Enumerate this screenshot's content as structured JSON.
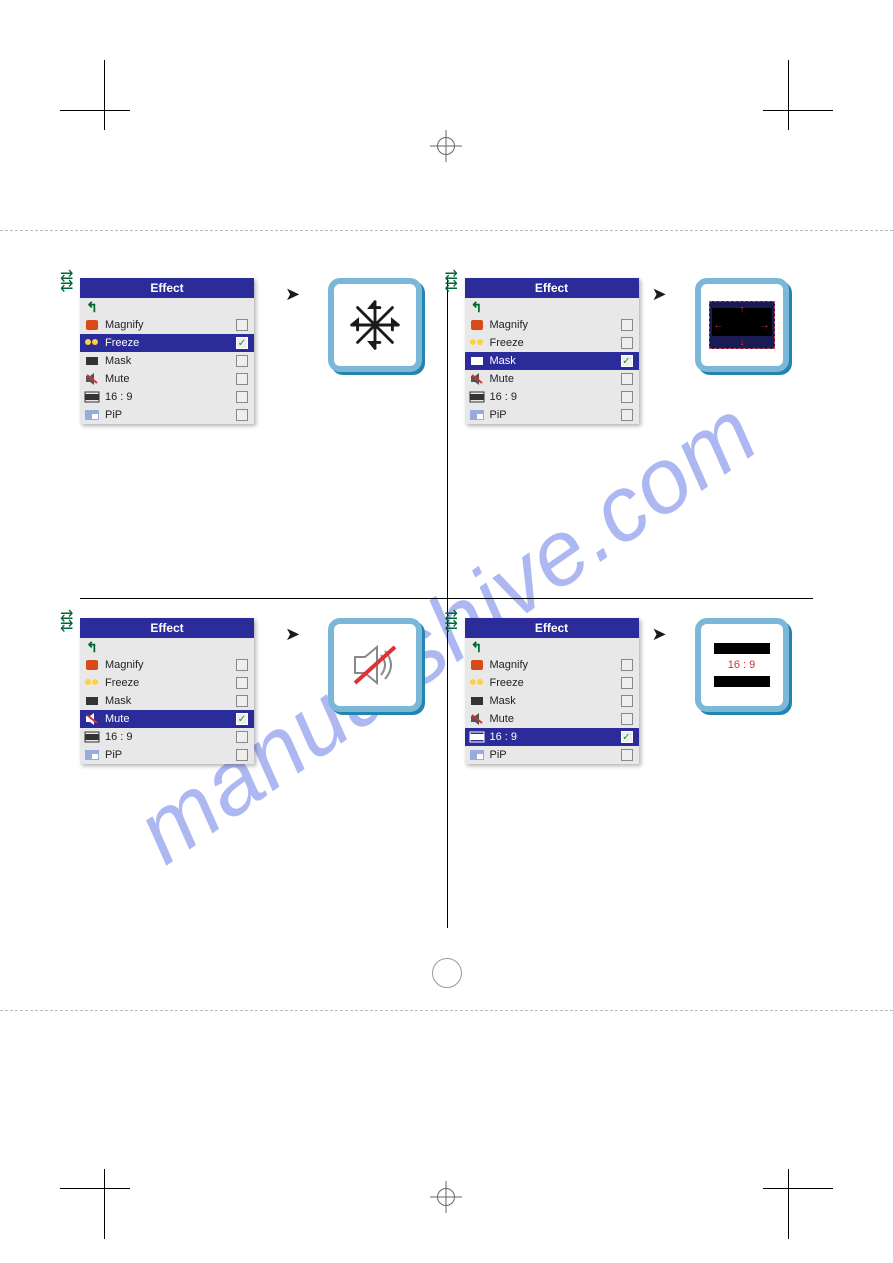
{
  "watermark": "manualshive.com",
  "page_number": "",
  "menu": {
    "title": "Effect",
    "items": [
      {
        "key": "back",
        "label": ""
      },
      {
        "key": "magnify",
        "label": "Magnify"
      },
      {
        "key": "freeze",
        "label": "Freeze"
      },
      {
        "key": "mask",
        "label": "Mask"
      },
      {
        "key": "mute",
        "label": "Mute"
      },
      {
        "key": "ratio",
        "label": "16 : 9"
      },
      {
        "key": "pip",
        "label": "PiP"
      }
    ]
  },
  "quads": {
    "q1": {
      "selected": "freeze",
      "result": "snowflake"
    },
    "q2": {
      "selected": "mask",
      "result": "mask"
    },
    "q3": {
      "selected": "mute",
      "result": "mute"
    },
    "q4": {
      "selected": "ratio",
      "result": "ratio"
    }
  },
  "ratio_text": "16 : 9"
}
